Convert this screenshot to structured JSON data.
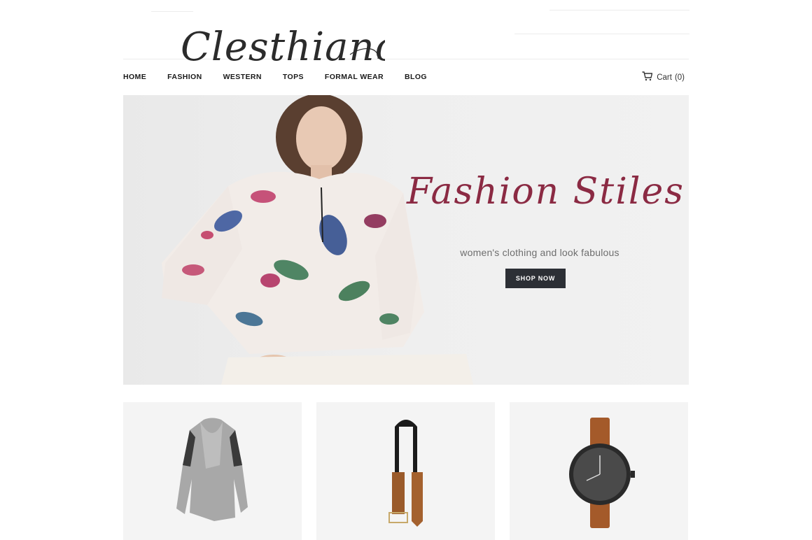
{
  "brand": {
    "logo_text": "Clesthiano"
  },
  "nav": {
    "items": [
      {
        "label": "HOME"
      },
      {
        "label": "FASHION"
      },
      {
        "label": "WESTERN"
      },
      {
        "label": "TOPS"
      },
      {
        "label": "FORMAL WEAR"
      },
      {
        "label": "BLOG"
      }
    ]
  },
  "cart": {
    "label": "Cart",
    "count": "(0)",
    "icon": "cart-icon"
  },
  "hero": {
    "title": "Fashion Stiles",
    "subtitle": "women's clothing and look fabulous",
    "cta": "SHOP NOW"
  },
  "products": [
    {
      "name": "grey-cardigan"
    },
    {
      "name": "leather-belt"
    },
    {
      "name": "brown-strap-watch"
    }
  ],
  "colors": {
    "accent": "#8b2a43",
    "button": "#2c2f35",
    "card_bg": "#f4f4f4"
  }
}
